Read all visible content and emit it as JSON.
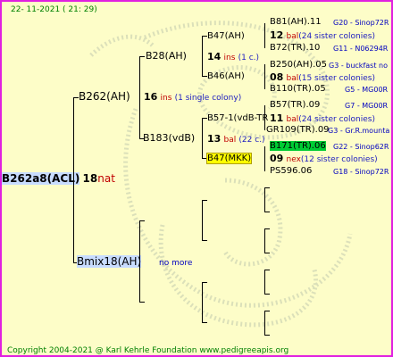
{
  "header": {
    "date": "22- 11-2021 ( 21: 29)"
  },
  "queen": {
    "name": "B262a8(ACL)",
    "num": "18",
    "suffix": "nat"
  },
  "sire_line": {
    "gen1": {
      "name": "B262(AH)",
      "num": "16",
      "suffix": "ins",
      "desc": "(1 single colony)"
    },
    "gen2a": {
      "name": "B28(AH)",
      "num": "14",
      "suffix": "ins",
      "desc": "(1 c.)"
    },
    "gen2b": {
      "name": "B183(vdB)",
      "num": "13",
      "suffix": "bal",
      "desc": "(22 c.)"
    },
    "gen3": [
      {
        "name": "B47(AH)"
      },
      {
        "name": "B46(AH)"
      },
      {
        "name": "B57-1(vdB-TR",
        "num": "11",
        "suffix": "bal",
        "desc": "(24 sister colonies)"
      },
      {
        "name": "B47(MKK)"
      }
    ],
    "gen4": [
      {
        "name": "B81(AH).11",
        "src": "G20 - Sinop72R"
      },
      {
        "num": "12",
        "suffix": "bal",
        "desc": "(24 sister colonies)"
      },
      {
        "name": "B72(TR).10",
        "src": "G11 - N06294R"
      },
      {
        "name": "B250(AH).05",
        "src": "G3 - buckfast no"
      },
      {
        "num": "08",
        "suffix": "bal",
        "desc": "(15 sister colonies)"
      },
      {
        "name": "B110(TR).05",
        "src": "G5 - MG00R"
      },
      {
        "name": "B57(TR).09",
        "src": "G7 - MG00R"
      },
      {
        "name": "GR109(TR).09",
        "src": "G3 - Gr.R.mounta"
      },
      {
        "name": "B171(TR).06",
        "src": "G22 - Sinop62R"
      },
      {
        "num": "09",
        "suffix": "nex",
        "desc": "(12 sister colonies)"
      },
      {
        "name": "PS596.06",
        "src": "G18 - Sinop72R"
      }
    ]
  },
  "dam_line": {
    "gen1": {
      "name": "Bmix18(AH)",
      "desc": "no more"
    }
  },
  "footer": {
    "text": "Copyright 2004-2021 @ Karl Kehrle Foundation   www.pedigreeapis.org"
  },
  "colors": {
    "background": "#fdfdc8",
    "border": "#e020e0",
    "green_highlight": "#00cc33",
    "yellow_highlight": "#ffff00"
  }
}
